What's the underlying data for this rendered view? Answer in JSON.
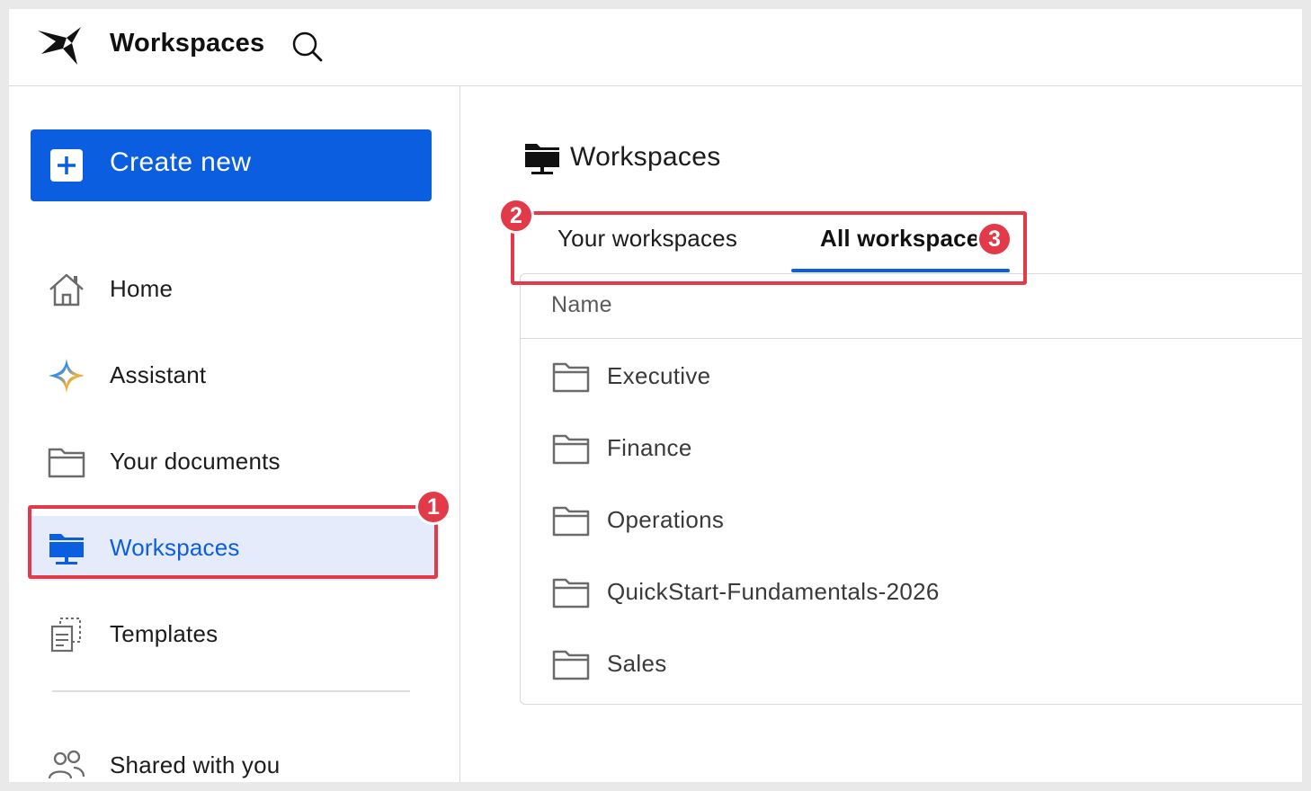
{
  "header": {
    "title": "Workspaces",
    "logo_icon": "bird-logo-icon",
    "search_icon": "search-icon"
  },
  "sidebar": {
    "create_new": {
      "label": "Create new",
      "icon": "plus-icon"
    },
    "items": [
      {
        "label": "Home",
        "icon": "home-icon"
      },
      {
        "label": "Assistant",
        "icon": "sparkle-icon"
      },
      {
        "label": "Your documents",
        "icon": "folder-icon"
      },
      {
        "label": "Workspaces",
        "icon": "workspace-folder-icon",
        "active": true
      },
      {
        "label": "Templates",
        "icon": "templates-icon"
      },
      {
        "label": "Shared with you",
        "icon": "people-icon"
      }
    ]
  },
  "main": {
    "title": "Workspaces",
    "tabs": [
      {
        "label": "Your workspaces",
        "active": false
      },
      {
        "label": "All workspaces",
        "active": true
      }
    ],
    "table": {
      "column_header": "Name",
      "rows": [
        {
          "name": "Executive"
        },
        {
          "name": "Finance"
        },
        {
          "name": "Operations"
        },
        {
          "name": "QuickStart-Fundamentals-2026"
        },
        {
          "name": "Sales"
        }
      ]
    }
  },
  "callouts": [
    "1",
    "2",
    "3"
  ],
  "colors": {
    "accent": "#0b5ee0",
    "active_bg": "#e5ebfb",
    "callout": "#e23a48"
  }
}
